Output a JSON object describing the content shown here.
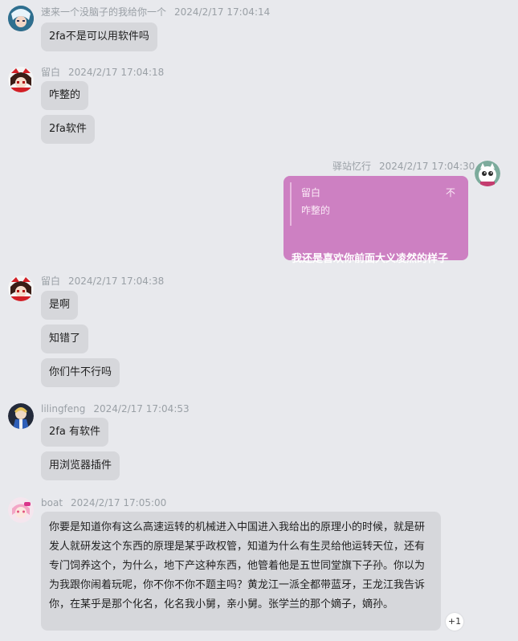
{
  "messages": [
    {
      "nickname": "速来一个没脑子的我给你一个",
      "time": "2024/2/17 17:04:14",
      "bubbles": [
        "2fa不是可以用软件吗"
      ],
      "avatar_icon": "anime-character-avatar-icon"
    },
    {
      "nickname": "留白",
      "time": "2024/2/17 17:04:18",
      "bubbles": [
        "咋整的",
        "2fa软件"
      ],
      "avatar_icon": "shrine-maiden-avatar-icon"
    },
    {
      "nickname": "驿站忆行",
      "time": "2024/2/17 17:04:30",
      "quote": {
        "name": "留白",
        "text": "咋整的",
        "close": "不"
      },
      "text": "我还是喜欢你前面大义凌然的样子",
      "avatar_icon": "white-cat-avatar-icon",
      "bubble_color": "#cd80c2"
    },
    {
      "nickname": "留白",
      "time": "2024/2/17 17:04:38",
      "bubbles": [
        "是啊",
        "知错了",
        "你们牛不行吗"
      ],
      "avatar_icon": "shrine-maiden-avatar-icon"
    },
    {
      "nickname": "lilingfeng",
      "time": "2024/2/17 17:04:53",
      "bubbles": [
        "2fa 有软件",
        "用浏览器插件"
      ],
      "avatar_icon": "blue-knight-avatar-icon"
    },
    {
      "nickname": "boat",
      "time": "2024/2/17 17:05:00",
      "bubbles": [
        "你要是知道你有这么高速运转的机械进入中国进入我给出的原理小的时候，就是研发人就研发这个东西的原理是某乎政权管，知道为什么有生灵给他运转天位，还有专门饲养这个，为什么，地下产这种东西，他管着他是五世同堂旗下子孙。你以为为我跟你闹着玩呢，你不你不你不题主吗？黄龙江一派全都带蓝牙，王龙江我告诉你，在某乎是那个化名，化名我小舅，亲小舅。张学兰的那个嫡子，嫡孙。"
      ],
      "avatar_icon": "pink-character-avatar-icon",
      "reaction": "+1"
    }
  ]
}
